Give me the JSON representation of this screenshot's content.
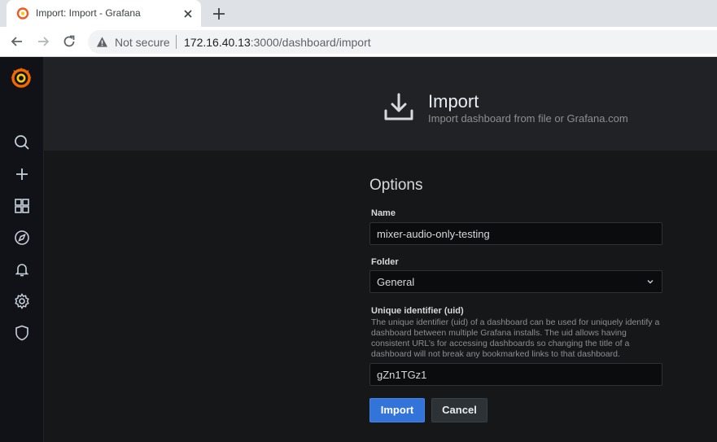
{
  "browser": {
    "tab_title": "Import: Import - Grafana",
    "security_label": "Not secure",
    "url_host": "172.16.40.13",
    "url_path": ":3000/dashboard/import"
  },
  "sidebar": {
    "items": [
      {
        "icon": "search-icon"
      },
      {
        "icon": "plus-icon"
      },
      {
        "icon": "dashboards-icon"
      },
      {
        "icon": "explore-icon"
      },
      {
        "icon": "bell-icon"
      },
      {
        "icon": "gear-icon"
      },
      {
        "icon": "shield-icon"
      }
    ]
  },
  "header": {
    "title": "Import",
    "subtitle": "Import dashboard from file or Grafana.com"
  },
  "form": {
    "section_title": "Options",
    "name_label": "Name",
    "name_value": "mixer-audio-only-testing",
    "folder_label": "Folder",
    "folder_value": "General",
    "uid_label": "Unique identifier (uid)",
    "uid_help": "The unique identifier (uid) of a dashboard can be used for uniquely identify a dashboard between multiple Grafana installs. The uid allows having consistent URL’s for accessing dashboards so changing the title of a dashboard will not break any bookmarked links to that dashboard.",
    "uid_value": "gZn1TGz1",
    "import_label": "Import",
    "cancel_label": "Cancel"
  },
  "colors": {
    "accent": "#3274d9",
    "sidebar_bg": "#111217",
    "page_bg": "#161719",
    "header_bg": "#202226"
  }
}
